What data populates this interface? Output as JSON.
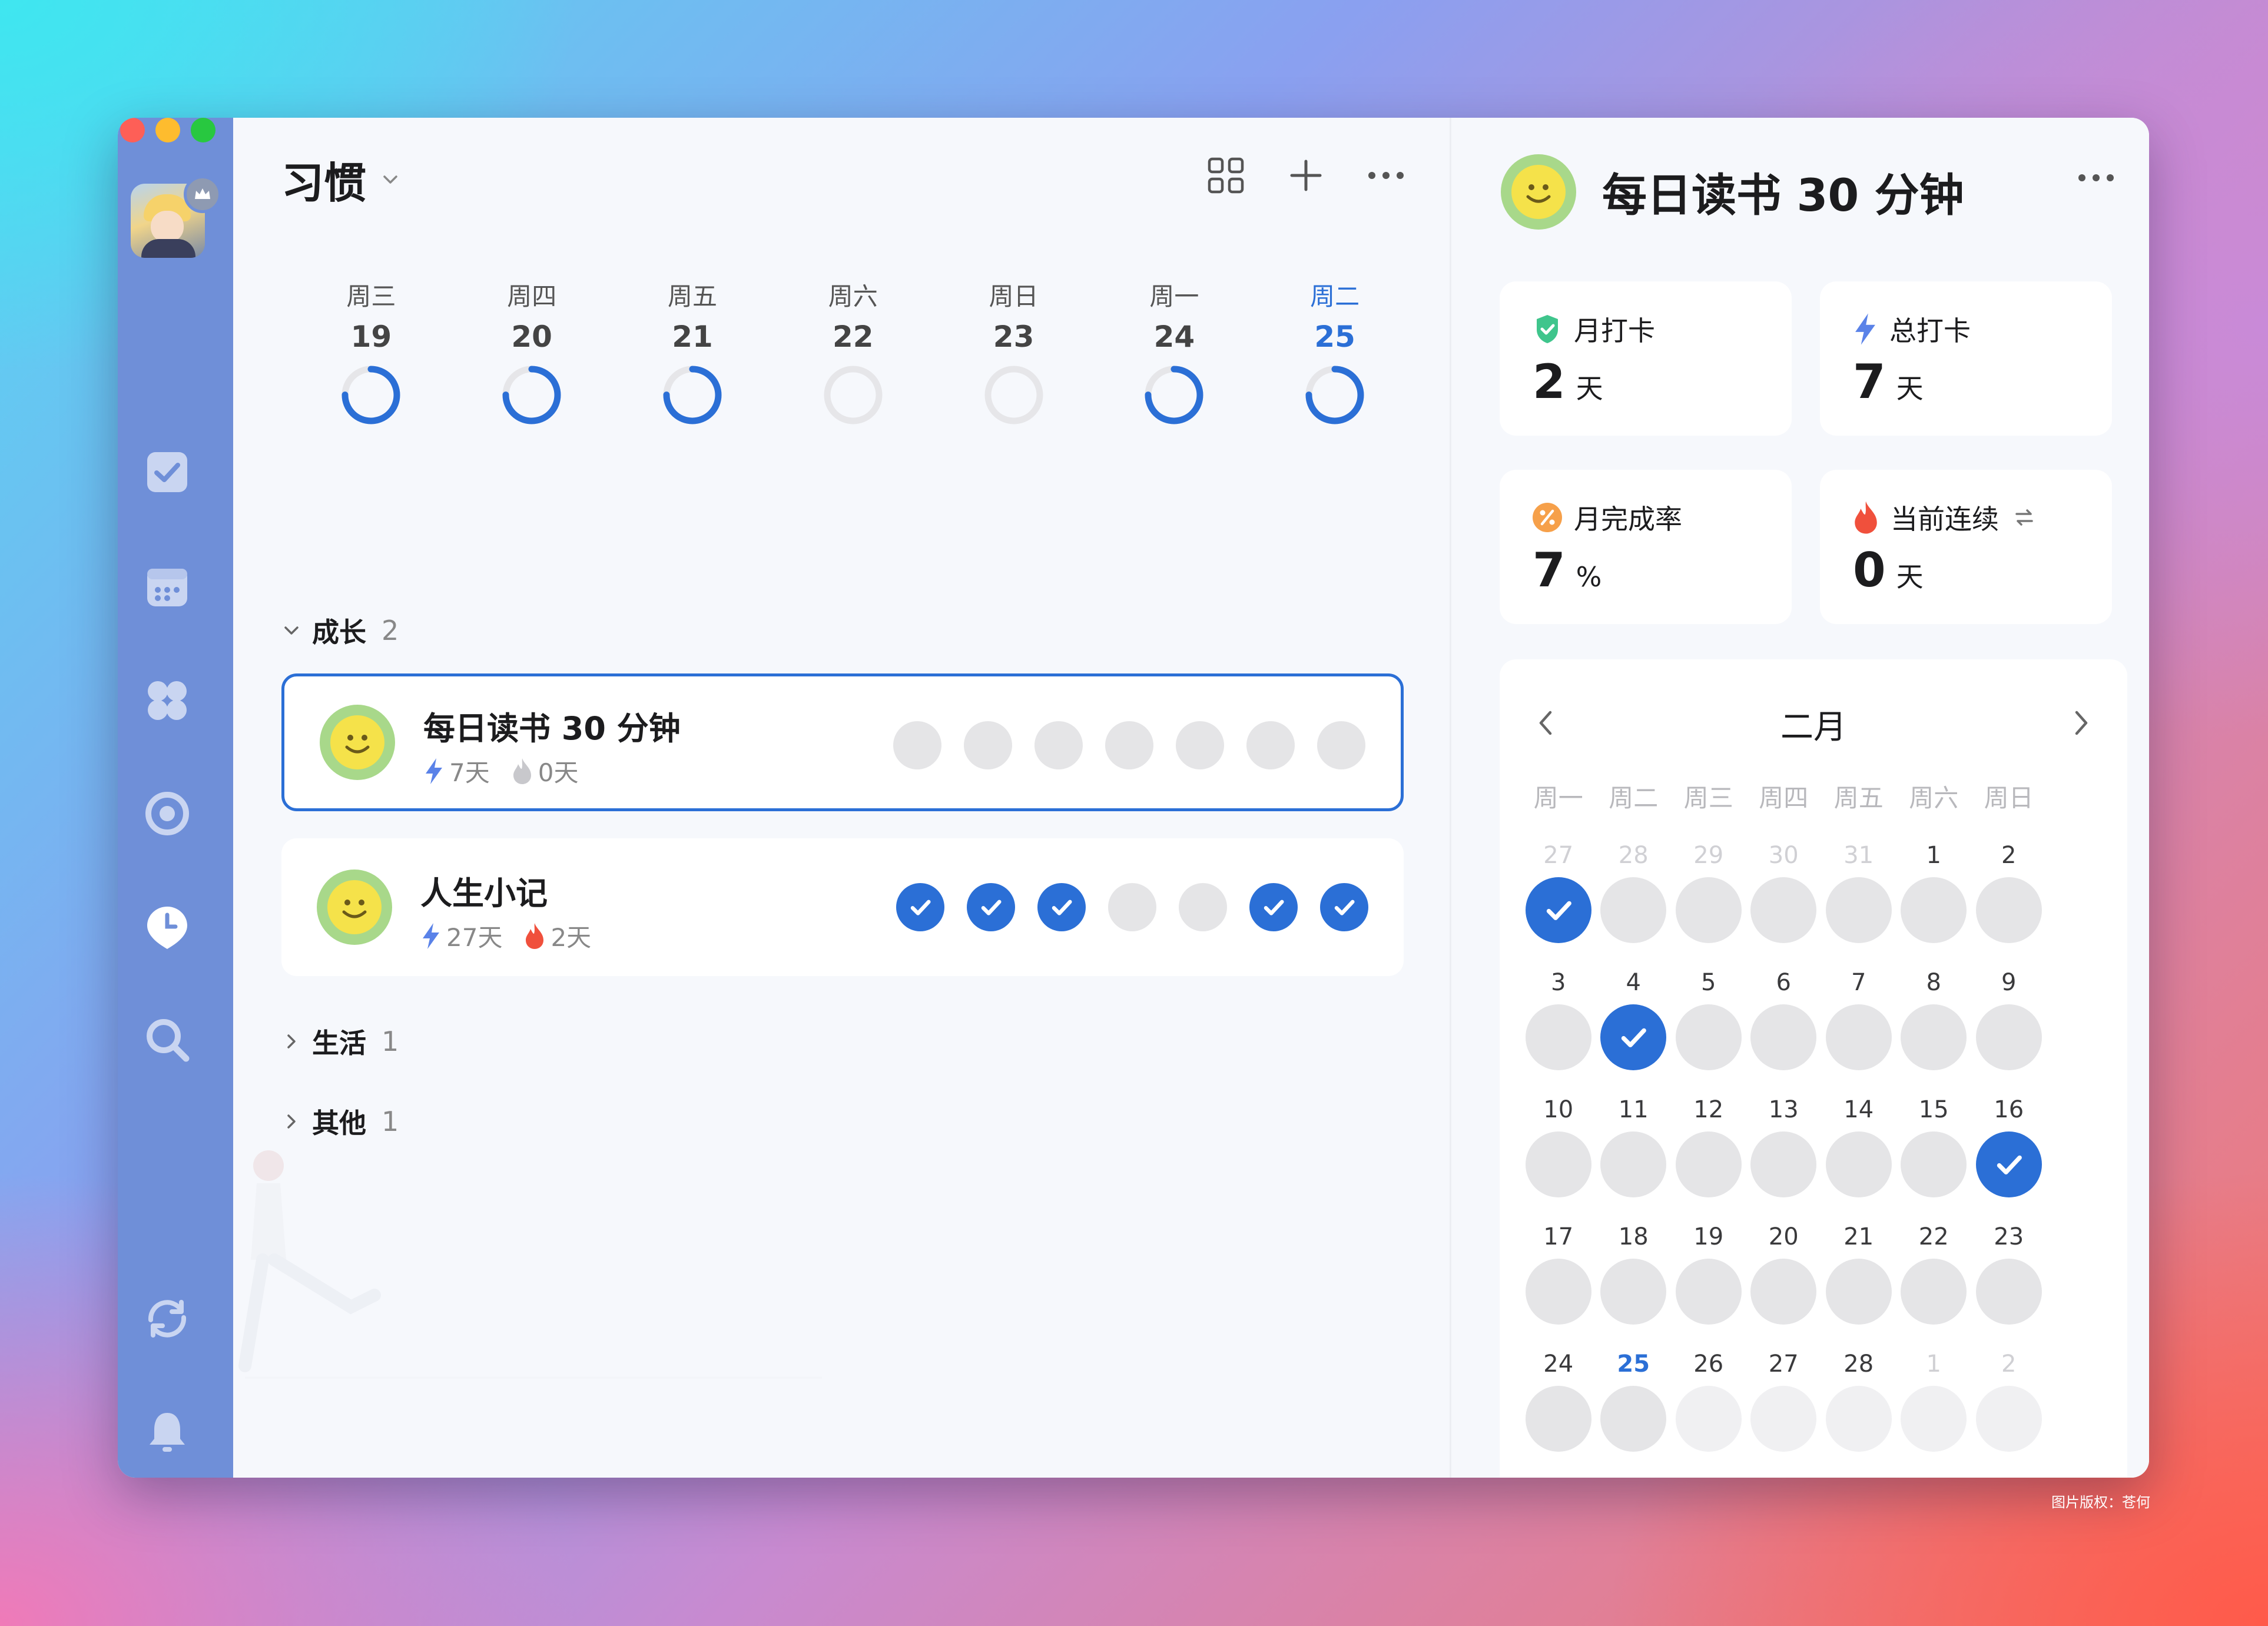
{
  "app": {
    "title": "习惯"
  },
  "toolbar": {
    "icons": [
      "grid-icon",
      "plus-icon",
      "more-icon"
    ]
  },
  "sidebar": {
    "icons": [
      "task-check-icon",
      "calendar-icon",
      "four-leaf-icon",
      "focus-target-icon",
      "habit-clock-icon",
      "search-icon",
      "sync-icon",
      "bell-icon",
      "help-icon"
    ]
  },
  "week": [
    {
      "label": "周三",
      "day": "19",
      "progress": 0.75
    },
    {
      "label": "周四",
      "day": "20",
      "progress": 0.75
    },
    {
      "label": "周五",
      "day": "21",
      "progress": 0.75
    },
    {
      "label": "周六",
      "day": "22",
      "progress": 0
    },
    {
      "label": "周日",
      "day": "23",
      "progress": 0
    },
    {
      "label": "周一",
      "day": "24",
      "progress": 0.75
    },
    {
      "label": "周二",
      "day": "25",
      "progress": 0.75,
      "today": true
    }
  ],
  "groups": [
    {
      "name": "成长",
      "count": "2",
      "expanded": true,
      "habits": [
        {
          "name": "每日读书 30 分钟",
          "total": "7天",
          "streak": "0天",
          "streak_active": false,
          "selected": true,
          "checks": [
            false,
            false,
            false,
            false,
            false,
            false,
            false
          ]
        },
        {
          "name": "人生小记",
          "total": "27天",
          "streak": "2天",
          "streak_active": true,
          "selected": false,
          "checks": [
            true,
            true,
            true,
            false,
            false,
            true,
            true
          ]
        }
      ]
    },
    {
      "name": "生活",
      "count": "1",
      "expanded": false
    },
    {
      "name": "其他",
      "count": "1",
      "expanded": false
    }
  ],
  "detail": {
    "title": "每日读书 30 分钟",
    "stats": {
      "monthly": {
        "label": "月打卡",
        "value": "2",
        "unit": "天"
      },
      "total": {
        "label": "总打卡",
        "value": "7",
        "unit": "天"
      },
      "rate": {
        "label": "月完成率",
        "value": "7",
        "unit": "%"
      },
      "streak": {
        "label": "当前连续",
        "value": "0",
        "unit": "天"
      }
    },
    "calendar": {
      "month": "二月",
      "weekdays": [
        "周一",
        "周二",
        "周三",
        "周四",
        "周五",
        "周六",
        "周日"
      ],
      "days": [
        {
          "d": "27",
          "other": true,
          "done": true
        },
        {
          "d": "28",
          "other": true
        },
        {
          "d": "29",
          "other": true
        },
        {
          "d": "30",
          "other": true
        },
        {
          "d": "31",
          "other": true
        },
        {
          "d": "1"
        },
        {
          "d": "2"
        },
        {
          "d": "3"
        },
        {
          "d": "4",
          "done": true
        },
        {
          "d": "5"
        },
        {
          "d": "6"
        },
        {
          "d": "7"
        },
        {
          "d": "8"
        },
        {
          "d": "9"
        },
        {
          "d": "10"
        },
        {
          "d": "11"
        },
        {
          "d": "12"
        },
        {
          "d": "13"
        },
        {
          "d": "14"
        },
        {
          "d": "15"
        },
        {
          "d": "16",
          "done": true
        },
        {
          "d": "17"
        },
        {
          "d": "18"
        },
        {
          "d": "19"
        },
        {
          "d": "20"
        },
        {
          "d": "21"
        },
        {
          "d": "22"
        },
        {
          "d": "23"
        },
        {
          "d": "24"
        },
        {
          "d": "25",
          "today": true
        },
        {
          "d": "26",
          "future": true
        },
        {
          "d": "27",
          "future": true
        },
        {
          "d": "28",
          "future": true
        },
        {
          "d": "1",
          "other": true,
          "future": true
        },
        {
          "d": "2",
          "other": true,
          "future": true
        }
      ]
    }
  },
  "footer": {
    "copyright": "图片版权：苍何"
  },
  "colors": {
    "accent": "#2b6fd6",
    "sidebar": "#6f8fd8",
    "emoji_ring": "#a8d88a",
    "emoji_face": "#f5e24a"
  }
}
